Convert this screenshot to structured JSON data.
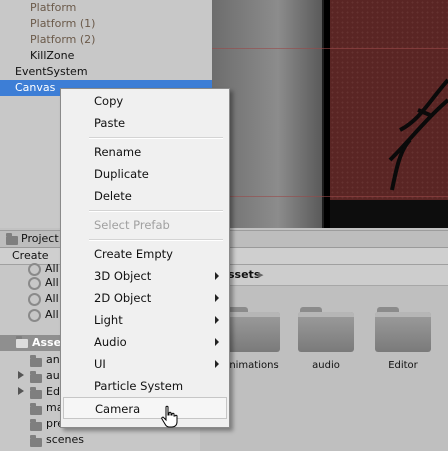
{
  "hierarchy": {
    "items": [
      {
        "label": "Platform"
      },
      {
        "label": "Platform (1)"
      },
      {
        "label": "Platform (2)"
      },
      {
        "label": "KillZone"
      },
      {
        "label": "EventSystem"
      },
      {
        "label": "Canvas"
      }
    ]
  },
  "project": {
    "tab_label": "Project",
    "create_label": "Create",
    "tree": {
      "search_items": [
        "All",
        "All",
        "All",
        "All"
      ],
      "assets_label": "Assets",
      "folders": [
        "an",
        "au",
        "Ed",
        "ma",
        "prefabs",
        "scenes"
      ]
    },
    "breadcrumb": "ssets",
    "grid_folders": [
      {
        "label": "nimations"
      },
      {
        "label": "audio"
      },
      {
        "label": "Editor"
      }
    ]
  },
  "context_menu": {
    "items": [
      {
        "label": "Copy"
      },
      {
        "label": "Paste"
      },
      {
        "label": "Rename"
      },
      {
        "label": "Duplicate"
      },
      {
        "label": "Delete"
      },
      {
        "label": "Select Prefab"
      },
      {
        "label": "Create Empty"
      },
      {
        "label": "3D Object"
      },
      {
        "label": "2D Object"
      },
      {
        "label": "Light"
      },
      {
        "label": "Audio"
      },
      {
        "label": "UI"
      },
      {
        "label": "Particle System"
      },
      {
        "label": "Camera"
      }
    ]
  },
  "colors": {
    "selection": "#3d7ed6",
    "scene_background": "#5a2524",
    "menu_background": "#f0f0f0"
  }
}
